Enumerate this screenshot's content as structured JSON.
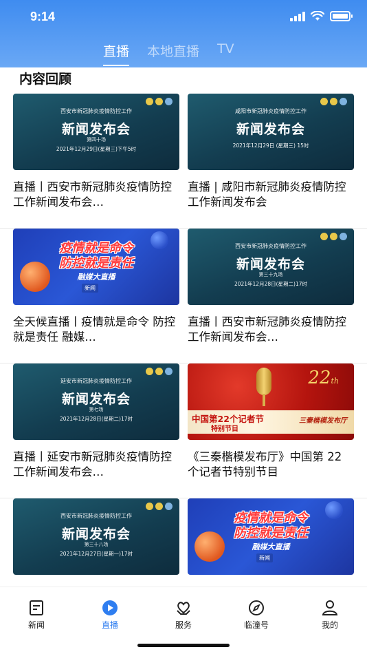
{
  "status_bar": {
    "time": "9:14"
  },
  "tabs": [
    {
      "label": "直播",
      "active": true
    },
    {
      "label": "本地直播",
      "active": false
    },
    {
      "label": "TV",
      "active": false
    }
  ],
  "section_title": "内容回顾",
  "cards": [
    {
      "kind": "press",
      "thumb": {
        "line1": "西安市新冠肺炎疫情防控工作",
        "line2": "新闻发布会",
        "line3": "第四十场",
        "line4": "2021年12月29日(星期三)下午5时"
      },
      "caption": "直播丨西安市新冠肺炎疫情防控工作新闻发布会…"
    },
    {
      "kind": "press",
      "thumb": {
        "line1": "咸阳市新冠肺炎疫情防控工作",
        "line2": "新闻发布会",
        "line3": "",
        "line4": "2021年12月29日 (星期三) 15时"
      },
      "caption": "直播 | 咸阳市新冠肺炎疫情防控工作新闻发布会"
    },
    {
      "kind": "slogan",
      "thumb": {
        "line1": "疫情就是命令",
        "line2": "防控就是责任",
        "line3": "融媒大直播",
        "line4": "新闻"
      },
      "caption": "全天候直播丨疫情就是命令 防控就是责任 融媒…"
    },
    {
      "kind": "press",
      "thumb": {
        "line1": "西安市新冠肺炎疫情防控工作",
        "line2": "新闻发布会",
        "line3": "第三十九场",
        "line4": "2021年12月28日(星期二)17时"
      },
      "caption": "直播丨西安市新冠肺炎疫情防控工作新闻发布会…"
    },
    {
      "kind": "press",
      "thumb": {
        "line1": "延安市新冠肺炎疫情防控工作",
        "line2": "新闻发布会",
        "line3": "第七场",
        "line4": "2021年12月28日(星期二)17时"
      },
      "caption": "直播丨延安市新冠肺炎疫情防控工作新闻发布会…"
    },
    {
      "kind": "jfest",
      "thumb": {
        "line1": "中国第22个记者节",
        "line2": "特别节目",
        "line3": "三秦楷模发布厅",
        "num": "22",
        "suffix": "th"
      },
      "caption": "《三秦楷模发布厅》中国第 22 个记者节特别节目"
    },
    {
      "kind": "press",
      "thumb": {
        "line1": "西安市新冠肺炎疫情防控工作",
        "line2": "新闻发布会",
        "line3": "第三十八场",
        "line4": "2021年12月27日(星期一)17时"
      },
      "caption": ""
    },
    {
      "kind": "slogan",
      "thumb": {
        "line1": "疫情就是命令",
        "line2": "防控就是责任",
        "line3": "融媒大直播",
        "line4": "新闻"
      },
      "caption": ""
    }
  ],
  "bottom_nav": [
    {
      "label": "新闻",
      "icon": "news-icon",
      "active": false
    },
    {
      "label": "直播",
      "icon": "live-play-icon",
      "active": true
    },
    {
      "label": "服务",
      "icon": "service-heart-icon",
      "active": false
    },
    {
      "label": "临潼号",
      "icon": "compass-icon",
      "active": false
    },
    {
      "label": "我的",
      "icon": "profile-icon",
      "active": false
    }
  ],
  "colors": {
    "accent": "#2f7ef0",
    "header": "#3f8cf0"
  }
}
